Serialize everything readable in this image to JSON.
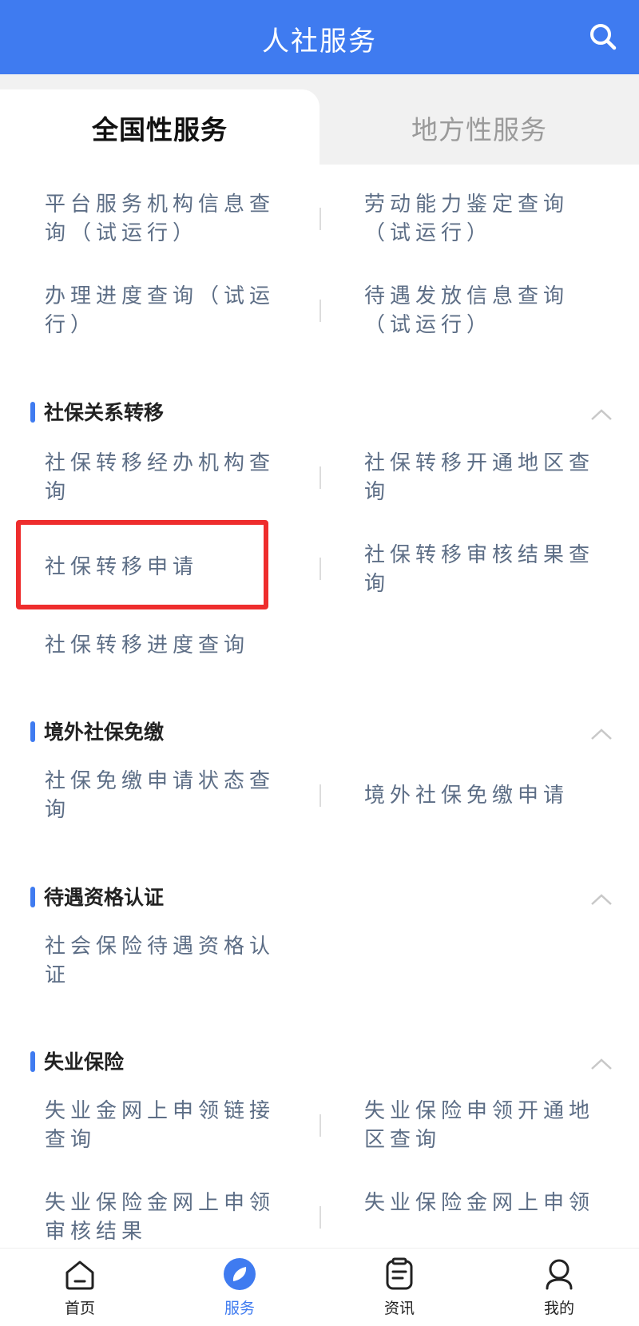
{
  "header": {
    "title": "人社服务"
  },
  "tabs": [
    {
      "label": "全国性服务",
      "active": true
    },
    {
      "label": "地方性服务",
      "active": false
    }
  ],
  "top_items": [
    "平台服务机构信息查询（试运行）",
    "劳动能力鉴定查询（试运行）",
    "办理进度查询（试运行）",
    "待遇发放信息查询（试运行）"
  ],
  "sections": [
    {
      "title": "社保关系转移",
      "items": [
        "社保转移经办机构查询",
        "社保转移开通地区查询",
        "社保转移申请",
        "社保转移审核结果查询",
        "社保转移进度查询"
      ]
    },
    {
      "title": "境外社保免缴",
      "items": [
        "社保免缴申请状态查询",
        "境外社保免缴申请"
      ]
    },
    {
      "title": "待遇资格认证",
      "items": [
        "社会保险待遇资格认证"
      ]
    },
    {
      "title": "失业保险",
      "items": [
        "失业金网上申领链接查询",
        "失业保险申领开通地区查询",
        "失业保险金网上申领审核结果",
        "失业保险金网上申领"
      ]
    }
  ],
  "bottom_nav": [
    {
      "label": "首页",
      "icon": "home-icon",
      "active": false
    },
    {
      "label": "服务",
      "icon": "compass-icon",
      "active": true
    },
    {
      "label": "资讯",
      "icon": "news-icon",
      "active": false
    },
    {
      "label": "我的",
      "icon": "user-icon",
      "active": false
    }
  ],
  "colors": {
    "primary": "#3f7bf0",
    "highlight": "#ee2d2d",
    "item_text": "#5d6e86"
  }
}
